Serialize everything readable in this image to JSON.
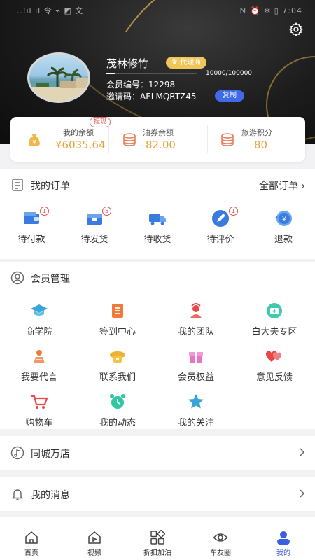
{
  "statusbar": {
    "left": "..⁝ıl ıl 令 ⌁ ◩ 文",
    "right": "Ｎ ⏰ ✻ ▯ 7:04"
  },
  "profile": {
    "name": "茂林修竹",
    "badge": "代理商",
    "progress_text": "10000/100000",
    "progress_fraction": 0.1,
    "member_no": "会员编号：12298",
    "invite": "邀请码：AELMQRTZ45",
    "copy_label": "复制"
  },
  "balances": [
    {
      "label": "我的余额",
      "value": "¥6035.64",
      "tag": "提现"
    },
    {
      "label": "油券余额",
      "value": "82.00"
    },
    {
      "label": "旅游积分",
      "value": "80"
    }
  ],
  "orders": {
    "title": "我的订单",
    "all": "全部订单",
    "items": [
      {
        "label": "待付款",
        "count": "1"
      },
      {
        "label": "待发货",
        "count": "5"
      },
      {
        "label": "待收货",
        "count": ""
      },
      {
        "label": "待评价",
        "count": "1"
      },
      {
        "label": "退款",
        "count": ""
      }
    ]
  },
  "member": {
    "title": "会员管理",
    "items": [
      "商学院",
      "签到中心",
      "我的团队",
      "白大夫专区",
      "我要代言",
      "联系我们",
      "会员权益",
      "意见反馈",
      "购物车",
      "我的动态",
      "我的关注"
    ]
  },
  "links": [
    {
      "label": "同城万店"
    },
    {
      "label": "我的消息"
    }
  ],
  "tabs": [
    {
      "label": "首页"
    },
    {
      "label": "视频"
    },
    {
      "label": "折扣加油"
    },
    {
      "label": "车友圈"
    },
    {
      "label": "我的"
    }
  ],
  "colors": {
    "accent": "#3b5ee0",
    "gold": "#e8a23a",
    "badge": "#f0c55a",
    "red": "#e05050"
  }
}
